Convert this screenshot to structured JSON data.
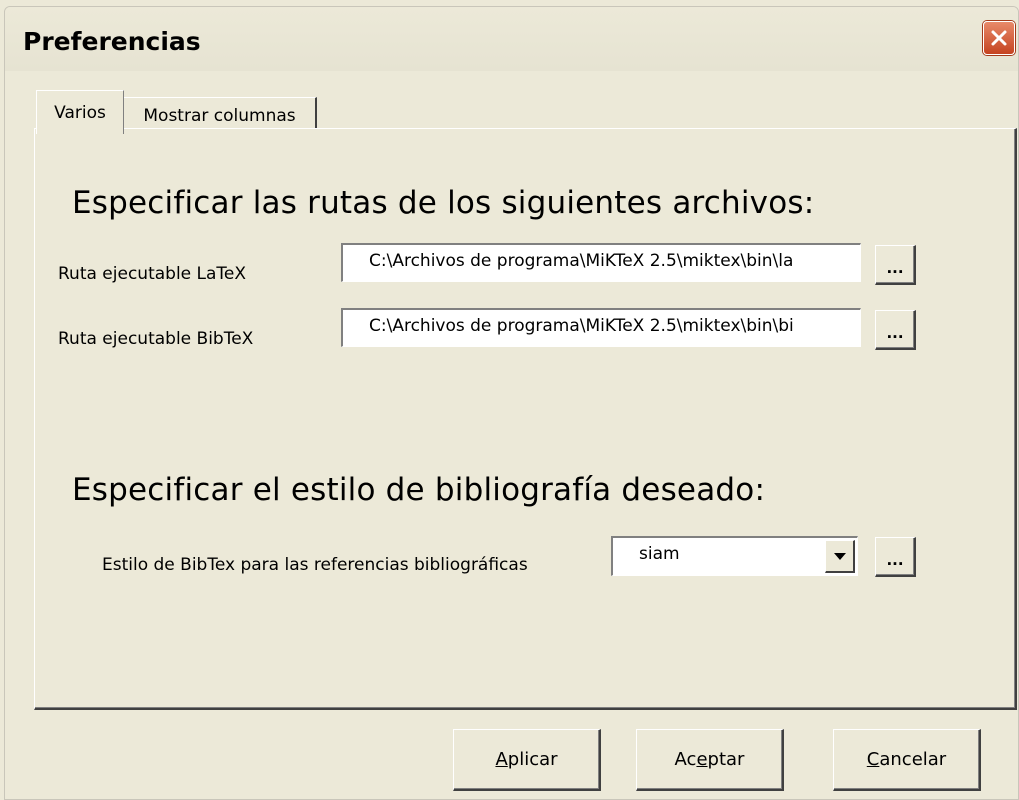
{
  "window": {
    "title": "Preferencias"
  },
  "tabs": [
    {
      "label": "Varios",
      "active": true
    },
    {
      "label": "Mostrar columnas",
      "active": false
    }
  ],
  "paths_section": {
    "heading": "Especificar las rutas de los siguientes archivos:",
    "latex_label": "Ruta ejecutable LaTeX",
    "latex_value": "C:\\Archivos de programa\\MiKTeX 2.5\\miktex\\bin\\la",
    "bibtex_label": "Ruta ejecutable BibTeX",
    "bibtex_value": "C:\\Archivos de programa\\MiKTeX 2.5\\miktex\\bin\\bi",
    "browse_label": "..."
  },
  "style_section": {
    "heading": "Especificar el estilo de bibliografía deseado:",
    "style_label": "Estilo de BibTex para las referencias bibliográficas",
    "style_value": "siam",
    "browse_label": "..."
  },
  "buttons": {
    "apply": {
      "pre": "",
      "accel": "A",
      "post": "plicar"
    },
    "accept": {
      "pre": "Ac",
      "accel": "e",
      "post": "ptar"
    },
    "cancel": {
      "pre": "",
      "accel": "C",
      "post": "ancelar"
    }
  }
}
